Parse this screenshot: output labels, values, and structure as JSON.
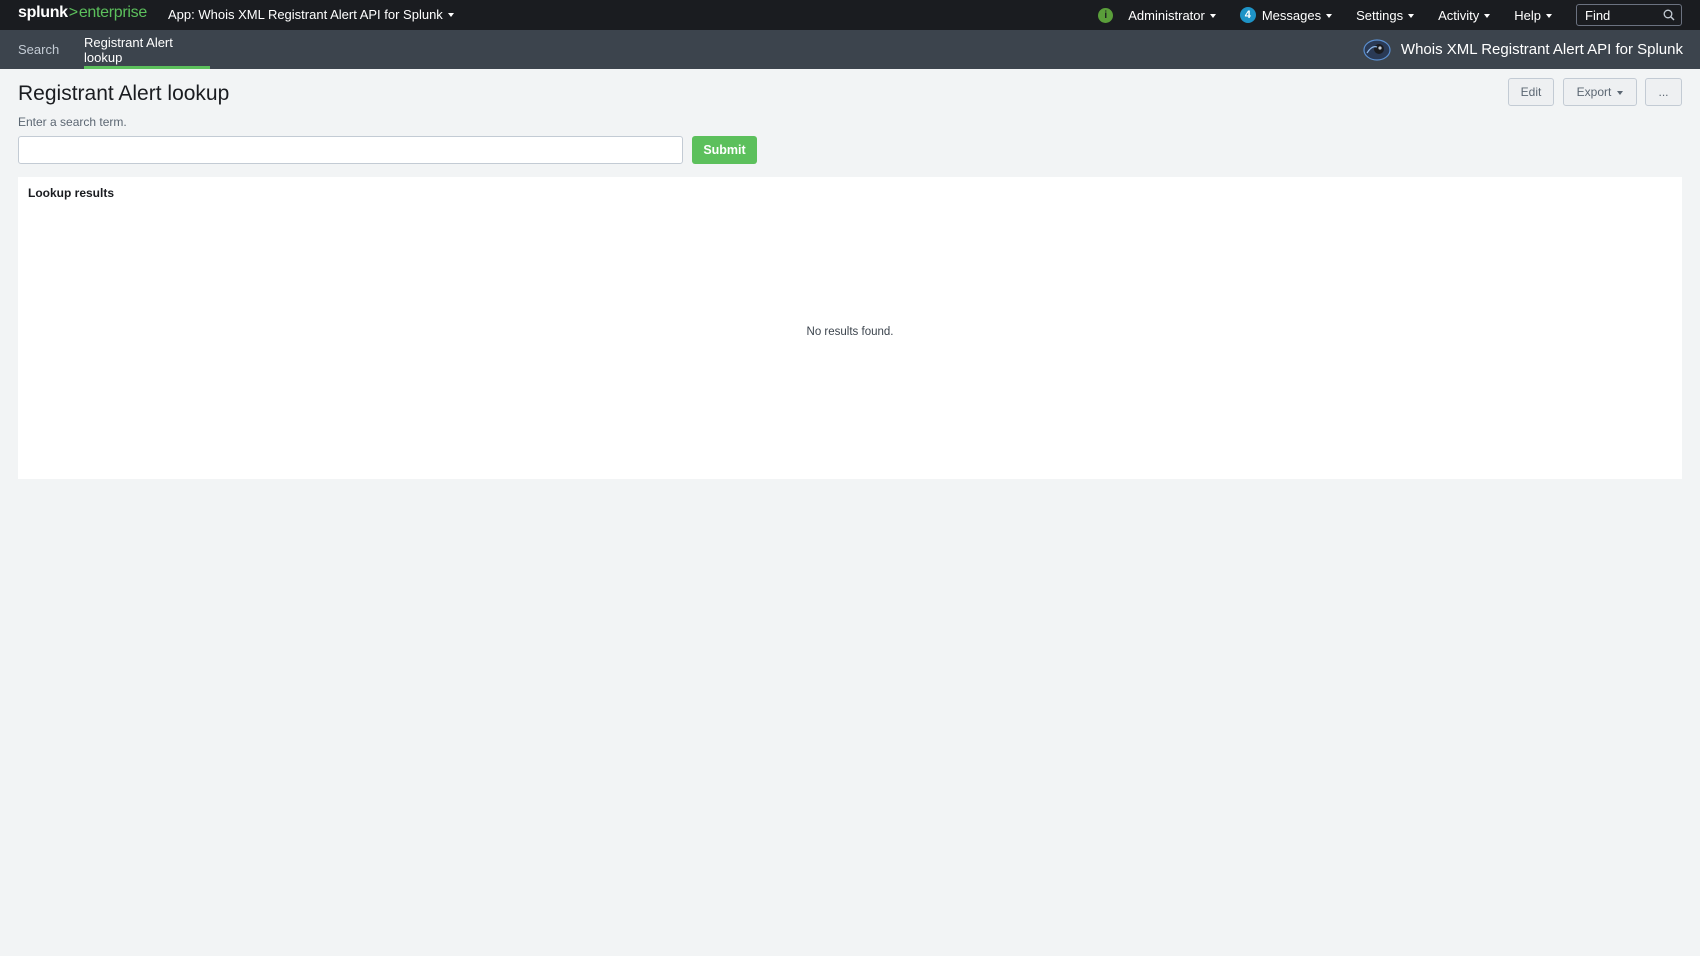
{
  "topbar": {
    "logo_main": "splunk",
    "logo_sep": ">",
    "logo_product": "enterprise",
    "app_menu_label": "App: Whois XML Registrant Alert API for Splunk",
    "health_icon_glyph": "i",
    "user_menu_label": "Administrator",
    "messages_count": "4",
    "messages_label": "Messages",
    "settings_label": "Settings",
    "activity_label": "Activity",
    "help_label": "Help",
    "find_placeholder": "Find"
  },
  "appbar": {
    "tabs": [
      {
        "label": "Search",
        "active": false
      },
      {
        "label": "Registrant Alert lookup",
        "active": true
      }
    ],
    "app_title": "Whois XML Registrant Alert API for Splunk"
  },
  "dashboard": {
    "title": "Registrant Alert lookup",
    "edit_label": "Edit",
    "export_label": "Export",
    "more_label": "...",
    "input_label": "Enter a search term.",
    "input_value": "",
    "submit_label": "Submit"
  },
  "panel": {
    "title": "Lookup results",
    "empty_message": "No results found."
  },
  "colors": {
    "accent_green": "#5cc05c",
    "topbar_bg": "#1a1c20",
    "appbar_bg": "#3c444d",
    "badge_blue": "#1e93c6",
    "page_bg": "#f2f4f5"
  }
}
